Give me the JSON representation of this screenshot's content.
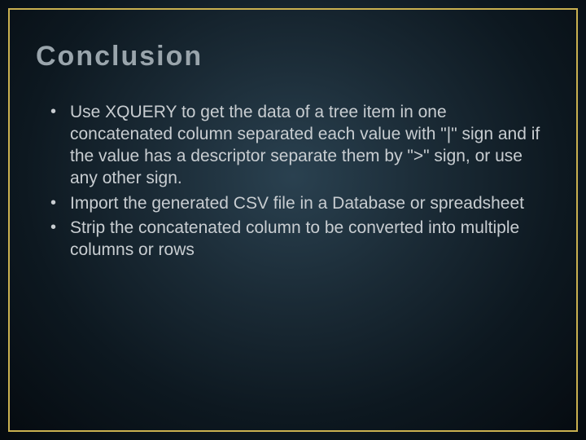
{
  "slide": {
    "title": "Conclusion",
    "bullets": [
      "Use XQUERY to get the data of a tree item in one concatenated column separated each value with \"|\" sign and if the value has a descriptor separate them by \">\" sign, or use any other sign.",
      "Import the generated CSV file in a Database or spreadsheet",
      "Strip the concatenated column to be converted into multiple columns or rows"
    ]
  }
}
